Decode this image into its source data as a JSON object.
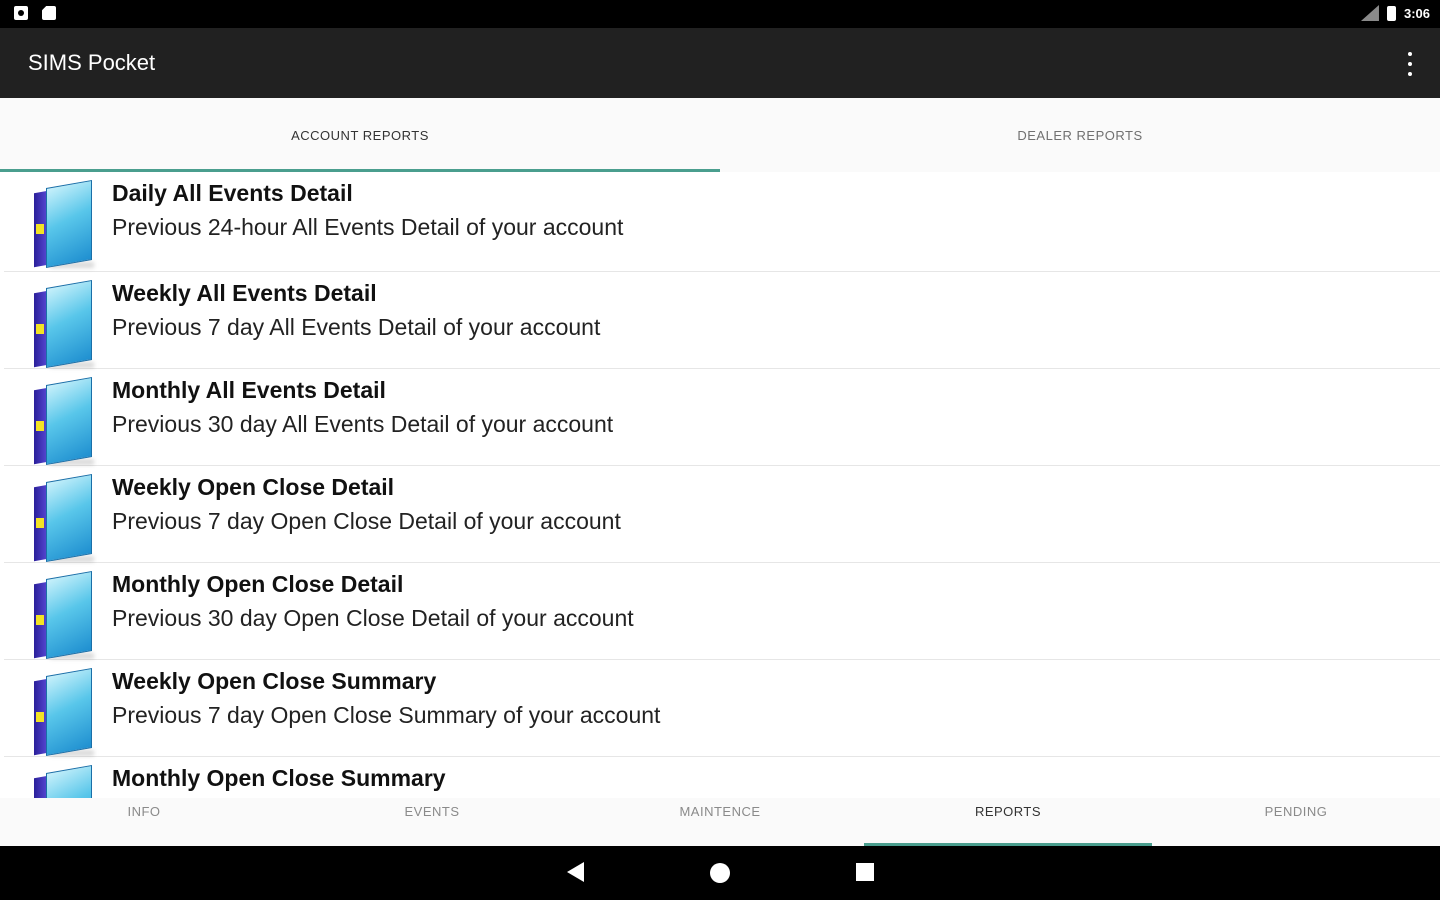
{
  "status_bar": {
    "time": "3:06"
  },
  "app_bar": {
    "title": "SIMS Pocket"
  },
  "top_tabs": [
    {
      "label": "ACCOUNT REPORTS",
      "active": true
    },
    {
      "label": "DEALER REPORTS",
      "active": false
    }
  ],
  "reports": [
    {
      "title": "Daily All Events Detail",
      "subtitle": "Previous 24-hour All Events Detail of your account"
    },
    {
      "title": "Weekly All Events Detail",
      "subtitle": "Previous 7 day All Events Detail of your account"
    },
    {
      "title": "Monthly All Events Detail",
      "subtitle": "Previous 30 day All Events Detail of your account"
    },
    {
      "title": "Weekly Open Close Detail",
      "subtitle": "Previous 7 day Open Close Detail of your account"
    },
    {
      "title": "Monthly Open Close Detail",
      "subtitle": "Previous 30 day Open Close Detail of your account"
    },
    {
      "title": "Weekly Open Close Summary",
      "subtitle": "Previous 7 day Open Close Summary of your account"
    },
    {
      "title": "Monthly Open Close Summary",
      "subtitle": ""
    }
  ],
  "bottom_tabs": [
    {
      "label": "INFO",
      "active": false
    },
    {
      "label": "EVENTS",
      "active": false
    },
    {
      "label": "MAINTENCE",
      "active": false
    },
    {
      "label": "REPORTS",
      "active": true
    },
    {
      "label": "PENDING",
      "active": false
    }
  ],
  "icons": {
    "report": "book-icon",
    "overflow": "more-vert-icon",
    "back": "back-icon",
    "home": "home-icon",
    "recent": "recent-apps-icon"
  },
  "colors": {
    "app_bar": "#212121",
    "tab_indicator": "#4a9e8e"
  }
}
